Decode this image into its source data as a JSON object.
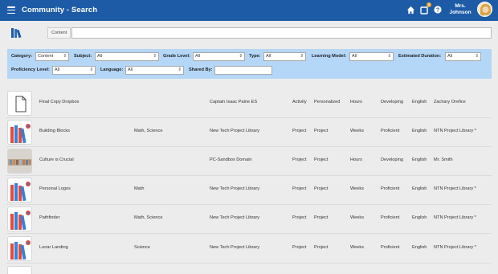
{
  "header": {
    "title": "Community - Search",
    "user_name_line1": "Mrs.",
    "user_name_line2": "Johnson",
    "notification_count": "1",
    "icons": [
      "menu-icon",
      "home-icon",
      "inbox-icon",
      "help-icon"
    ],
    "colors": {
      "bar": "#1d5ba6",
      "filter_panel": "#b4d6f7",
      "badge": "#f5a623"
    }
  },
  "search": {
    "label": "Content",
    "value": ""
  },
  "filters": {
    "category": {
      "label": "Category:",
      "value": "Content"
    },
    "subject": {
      "label": "Subject:",
      "value": "All"
    },
    "grade_level": {
      "label": "Grade Level:",
      "value": "All"
    },
    "type": {
      "label": "Type:",
      "value": "All"
    },
    "learning_model": {
      "label": "Learning Model:",
      "value": "All"
    },
    "estimated_duration": {
      "label": "Estimated Duration:",
      "value": "All"
    },
    "proficiency_level": {
      "label": "Proficiency Level:",
      "value": "All"
    },
    "language": {
      "label": "Language:",
      "value": "All"
    },
    "shared_by": {
      "label": "Shared By:",
      "value": ""
    }
  },
  "results": [
    {
      "title": "Final Copy Dropbox",
      "subject": "",
      "source": "Captain Isaac Paine ES",
      "type": "Activity",
      "model": "Personalized",
      "duration": "Hours",
      "proficiency": "Developing",
      "language": "English",
      "shared_by": "Zachary Orefice",
      "thumb": "document-icon"
    },
    {
      "title": "Building Blocks",
      "subject": "Math, Science",
      "source": "New Tech Project Library",
      "type": "Project",
      "model": "Project",
      "duration": "Weeks",
      "proficiency": "Proficient",
      "language": "English",
      "shared_by": "NTN Project Library *",
      "thumb": "books-icon"
    },
    {
      "title": "Culture is Crucial",
      "subject": "",
      "source": "PC-Sandbox Domain",
      "type": "Project",
      "model": "Project",
      "duration": "Hours",
      "proficiency": "Developing",
      "language": "English",
      "shared_by": "Mr. Smith",
      "thumb": "photo-thumbnail"
    },
    {
      "title": "Personal Logos",
      "subject": "Math",
      "source": "New Tech Project Library",
      "type": "Project",
      "model": "Project",
      "duration": "Weeks",
      "proficiency": "Proficient",
      "language": "English",
      "shared_by": "NTN Project Library *",
      "thumb": "books-icon"
    },
    {
      "title": "Pathfinder",
      "subject": "Math, Science",
      "source": "New Tech Project Library",
      "type": "Project",
      "model": "Project",
      "duration": "Weeks",
      "proficiency": "Proficient",
      "language": "English",
      "shared_by": "NTN Project Library *",
      "thumb": "books-icon"
    },
    {
      "title": "Lunar Landing",
      "subject": "Science",
      "source": "New Tech Project Library",
      "type": "Project",
      "model": "Project",
      "duration": "Weeks",
      "proficiency": "Proficient",
      "language": "English",
      "shared_by": "NTN Project Library *",
      "thumb": "books-icon"
    }
  ]
}
